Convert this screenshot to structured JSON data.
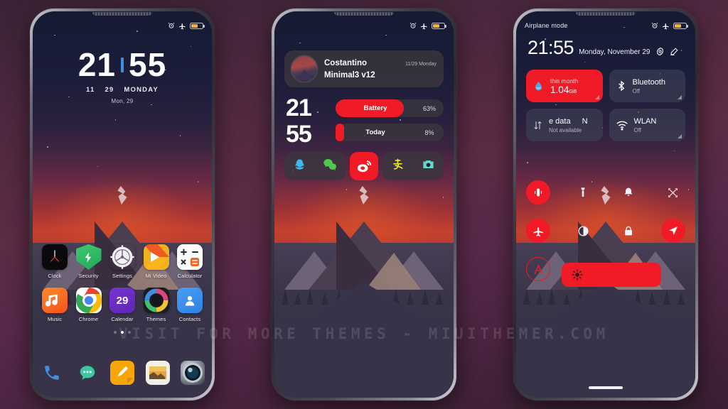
{
  "watermark": "VISIT FOR MORE THEMES - MIUITHEMER.COM",
  "theme": {
    "accent_red": "#f01b26",
    "accent_blue": "#3d8fe0",
    "battery_amber": "#e8b24a"
  },
  "phone1": {
    "statusbar": {
      "left_text": "",
      "icons": [
        "alarm-icon",
        "airplane-icon",
        "battery-icon"
      ],
      "battery_level": "63"
    },
    "clock": {
      "hours": "21",
      "minutes": "55",
      "separator": "|"
    },
    "date_parts": [
      "11",
      "29",
      "MONDAY"
    ],
    "date_sub": "Mon, 29",
    "apps_row1": [
      {
        "label": "Clock",
        "icon": "clock-icon"
      },
      {
        "label": "Security",
        "icon": "security-shield-icon"
      },
      {
        "label": "Settings",
        "icon": "settings-gear-icon"
      },
      {
        "label": "Mi Video",
        "icon": "mi-video-icon"
      },
      {
        "label": "Calculator",
        "icon": "calculator-icon"
      }
    ],
    "apps_row2": [
      {
        "label": "Music",
        "icon": "music-icon"
      },
      {
        "label": "Chrome",
        "icon": "chrome-icon"
      },
      {
        "label": "Calendar",
        "icon": "calendar-icon",
        "day": "29"
      },
      {
        "label": "Themes",
        "icon": "themes-icon"
      },
      {
        "label": "Contacts",
        "icon": "contacts-icon"
      }
    ],
    "page_dots": {
      "count": 3,
      "active": 2
    },
    "dock": [
      {
        "name": "Phone",
        "icon": "phone-icon"
      },
      {
        "name": "Messages",
        "icon": "message-bubble-icon"
      },
      {
        "name": "Notes",
        "icon": "notes-pencil-icon"
      },
      {
        "name": "Gallery",
        "icon": "gallery-icon"
      },
      {
        "name": "Camera",
        "icon": "camera-lens-icon"
      }
    ]
  },
  "phone2": {
    "statusbar": {
      "icons": [
        "alarm-icon",
        "airplane-icon",
        "battery-icon"
      ]
    },
    "profile": {
      "name": "Costantino",
      "theme": "Minimal3 v12",
      "date": "11/29 Monday",
      "avatar": "mountain-avatar"
    },
    "clock": {
      "hours": "21",
      "minutes": "55"
    },
    "bars": [
      {
        "label": "Battery",
        "value": "63%",
        "percent": 63
      },
      {
        "label": "Today",
        "value": "8%",
        "percent": 8
      }
    ],
    "socials": [
      {
        "name": "QQ",
        "icon": "qq-penguin-icon",
        "highlighted": false
      },
      {
        "name": "WeChat",
        "icon": "wechat-icon",
        "highlighted": false
      },
      {
        "name": "Weibo",
        "icon": "weibo-icon",
        "highlighted": true
      },
      {
        "name": "Alipay",
        "icon": "alipay-icon",
        "highlighted": false
      },
      {
        "name": "Camera",
        "icon": "camera-icon",
        "highlighted": false
      }
    ]
  },
  "phone3": {
    "statusbar": {
      "left_text": "Airplane mode",
      "icons": [
        "alarm-icon",
        "airplane-icon",
        "battery-icon"
      ]
    },
    "clock": {
      "time": "21:55",
      "date": "Monday, November 29"
    },
    "header_icons": [
      "settings-gear-icon",
      "edit-pencil-icon"
    ],
    "tiles": [
      {
        "id": "data-usage",
        "icon": "water-drop-icon",
        "title": "this month",
        "value": "1.04",
        "unit": "GB",
        "active": true
      },
      {
        "id": "bluetooth",
        "icon": "bluetooth-icon",
        "label": "Bluetooth",
        "status": "Off",
        "active": false
      },
      {
        "id": "mobile-data",
        "icon": "data-arrows-icon",
        "label": "e data",
        "label2": "N",
        "status": "Not available",
        "active": false
      },
      {
        "id": "wlan",
        "icon": "wifi-icon",
        "label": "WLAN",
        "status": "Off",
        "active": false
      }
    ],
    "toggles_row1": [
      {
        "name": "Vibrate",
        "icon": "vibrate-icon",
        "state": "on"
      },
      {
        "name": "Flashlight",
        "icon": "flashlight-icon",
        "state": "off"
      },
      {
        "name": "Do not disturb",
        "icon": "bell-icon",
        "state": "off"
      },
      {
        "name": "Screenshot",
        "icon": "screenshot-icon",
        "state": "off"
      }
    ],
    "toggles_row2": [
      {
        "name": "Airplane mode",
        "icon": "airplane-icon",
        "state": "on"
      },
      {
        "name": "Dark mode",
        "icon": "dark-mode-icon",
        "state": "off"
      },
      {
        "name": "Lock",
        "icon": "lock-icon",
        "state": "off"
      },
      {
        "name": "Location",
        "icon": "location-arrow-icon",
        "state": "on"
      }
    ],
    "toggles_row3": [
      {
        "name": "Auto brightness",
        "icon": "letter-a-icon",
        "state": "ring"
      }
    ],
    "brightness": {
      "icon": "brightness-sun-icon",
      "level": 100
    }
  }
}
